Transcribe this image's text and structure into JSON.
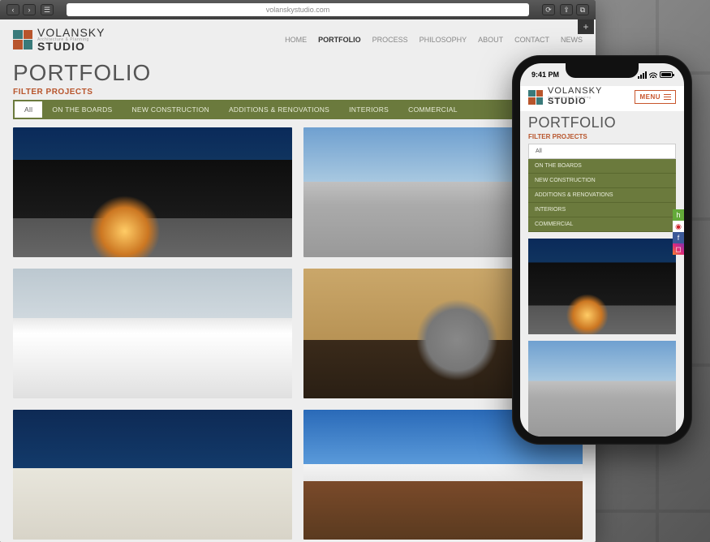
{
  "browser": {
    "url": "volanskystudio.com"
  },
  "site": {
    "logo_primary": "VOLANSKY",
    "logo_secondary": "STUDIO",
    "logo_tagline": "Architecture & Planning",
    "nav": [
      "HOME",
      "PORTFOLIO",
      "PROCESS",
      "PHILOSOPHY",
      "ABOUT",
      "CONTACT",
      "NEWS"
    ],
    "nav_active": "PORTFOLIO",
    "page_title": "PORTFOLIO",
    "filter_label": "FILTER PROJECTS",
    "filters": [
      "All",
      "ON THE BOARDS",
      "NEW CONSTRUCTION",
      "ADDITIONS & RENOVATIONS",
      "INTERIORS",
      "COMMERCIAL"
    ],
    "filter_active": "All"
  },
  "mobile": {
    "time": "9:41 PM",
    "menu_label": "MENU",
    "page_title": "PORTFOLIO",
    "filter_label": "FILTER PROJECTS",
    "filters": [
      "All",
      "ON THE BOARDS",
      "NEW CONSTRUCTION",
      "ADDITIONS & RENOVATIONS",
      "INTERIORS",
      "COMMERCIAL"
    ],
    "filter_active": "All"
  }
}
